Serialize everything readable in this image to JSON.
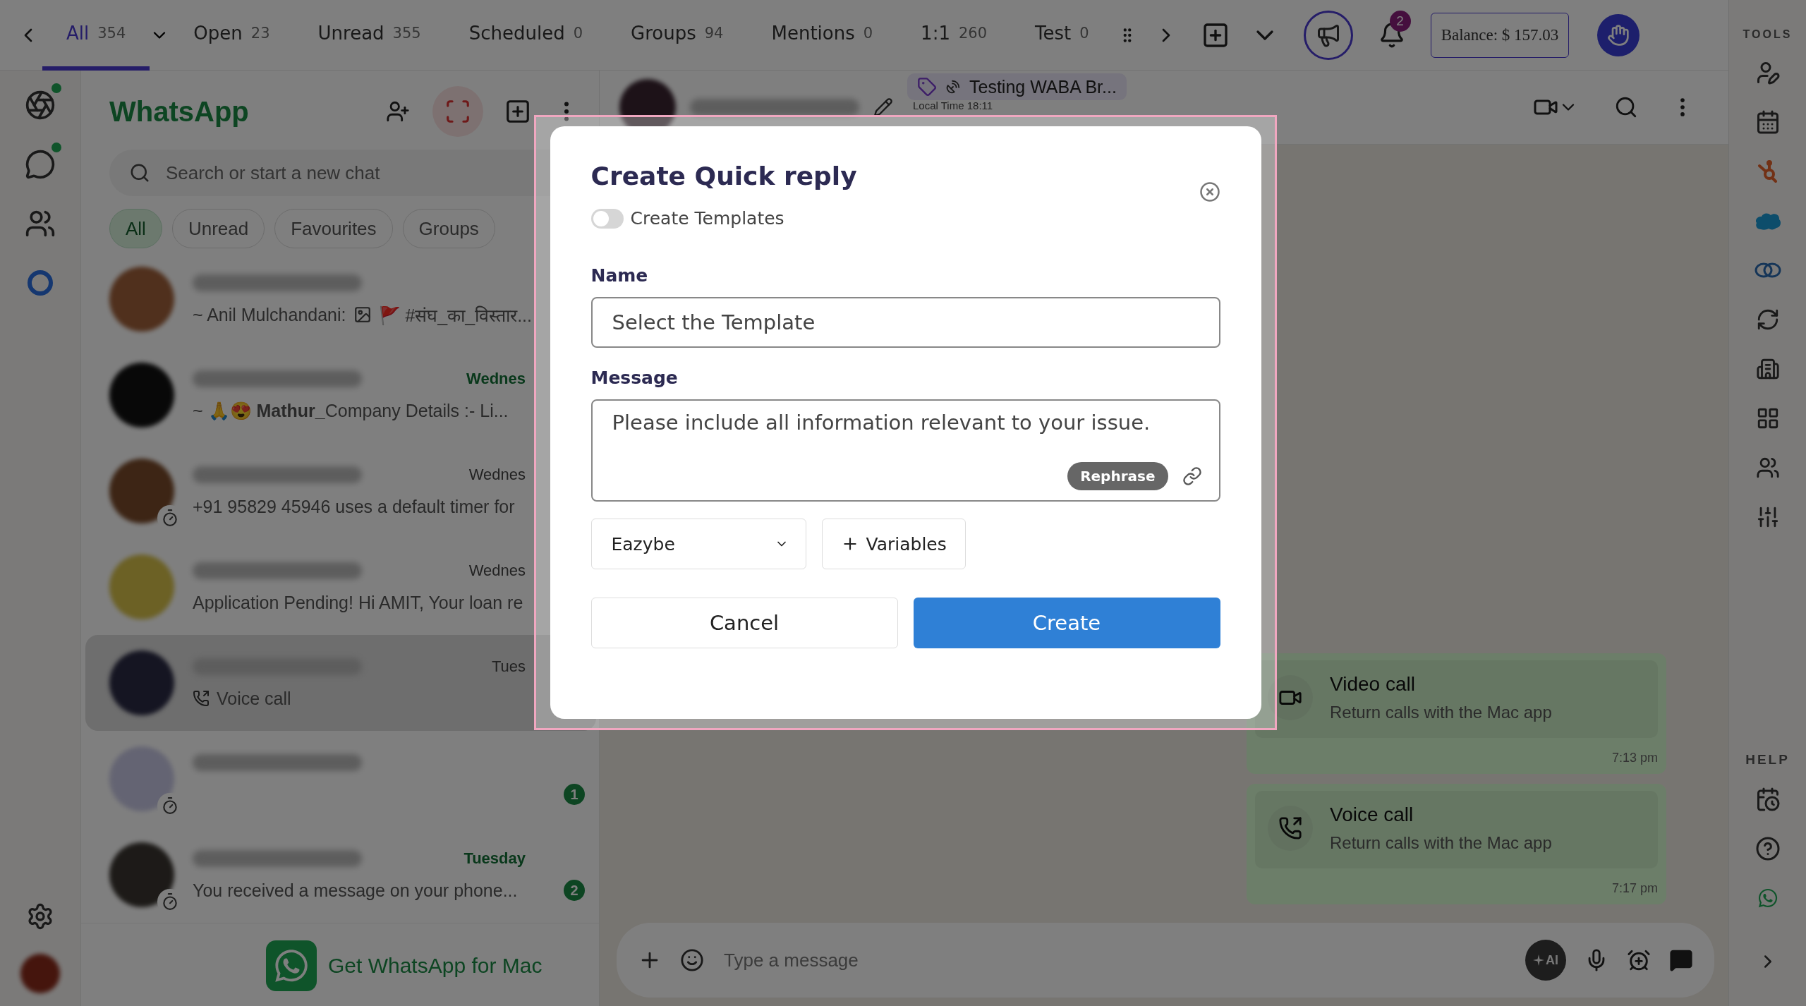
{
  "top_tabs": [
    {
      "label": "All",
      "count": "354",
      "selected": true
    },
    {
      "label": "Open",
      "count": "23",
      "selected": false
    },
    {
      "label": "Unread",
      "count": "355",
      "selected": false
    },
    {
      "label": "Scheduled",
      "count": "0",
      "selected": false
    },
    {
      "label": "Groups",
      "count": "94",
      "selected": false
    },
    {
      "label": "Mentions",
      "count": "0",
      "selected": false
    },
    {
      "label": "1:1",
      "count": "260",
      "selected": false
    },
    {
      "label": "Test",
      "count": "0",
      "selected": false
    }
  ],
  "top_bar": {
    "notification_count": "2",
    "balance": "Balance: $ 157.03"
  },
  "left_rail": {
    "status_dot": true,
    "chats_dot": true
  },
  "chat_list": {
    "title": "WhatsApp",
    "search_placeholder": "Search or start a new chat",
    "filters": [
      {
        "label": "All",
        "selected": true
      },
      {
        "label": "Unread",
        "selected": false
      },
      {
        "label": "Favourites",
        "selected": false
      },
      {
        "label": "Groups",
        "selected": false
      }
    ],
    "chats": [
      {
        "sender": "~ Anil Mulchandani:",
        "image": true,
        "preview": "🚩 #संघ_का_विस्तार...",
        "time_green": false,
        "timer": false,
        "selected": false
      },
      {
        "time": "Wednes",
        "time_green": true,
        "preview": "~ 🙏😍 **Mathur_**Company Details :-  Li...",
        "timer": false,
        "selected": false
      },
      {
        "time": "Wednes",
        "time_green": false,
        "preview": "+91 95829 45946 uses a default timer for",
        "timer": true,
        "selected": false
      },
      {
        "time": "Wednes",
        "time_green": false,
        "preview": "Application Pending! Hi AMIT, Your loan re",
        "timer": false,
        "selected": false
      },
      {
        "time": "Tues",
        "time_green": false,
        "call_icon": true,
        "preview": "Voice call",
        "timer": false,
        "selected": true
      },
      {
        "timer": true,
        "unread": "1",
        "selected": false
      },
      {
        "time": "Tuesday",
        "time_green": true,
        "preview": "You received a message on your phone...",
        "timer": true,
        "unread": "2",
        "selected": false
      }
    ],
    "footer": "Get WhatsApp for Mac"
  },
  "chat": {
    "tag": "Testing WABA Br...",
    "local_time": "Local Time 18:11",
    "messages": [
      {
        "kind": "video",
        "title": "Video call",
        "subtitle": "Return calls with the Mac app",
        "time": "7:13 pm"
      },
      {
        "kind": "voice",
        "title": "Voice call",
        "subtitle": "Return calls with the Mac app",
        "time": "7:17 pm"
      }
    ],
    "composer": {
      "placeholder": "Type a message",
      "ai_label": "AI"
    }
  },
  "tools": {
    "title": "TOOLS",
    "help_title": "HELP"
  },
  "modal": {
    "title": "Create Quick reply",
    "toggle": {
      "label": "Create Templates",
      "on": false
    },
    "name_label": "Name",
    "name_placeholder": "Select the Template",
    "message_label": "Message",
    "message_placeholder": "Please include all information relevant to your issue.",
    "rephrase": "Rephrase",
    "dropdown": "Eazybe",
    "variables": "Variables",
    "cancel": "Cancel",
    "create": "Create"
  }
}
